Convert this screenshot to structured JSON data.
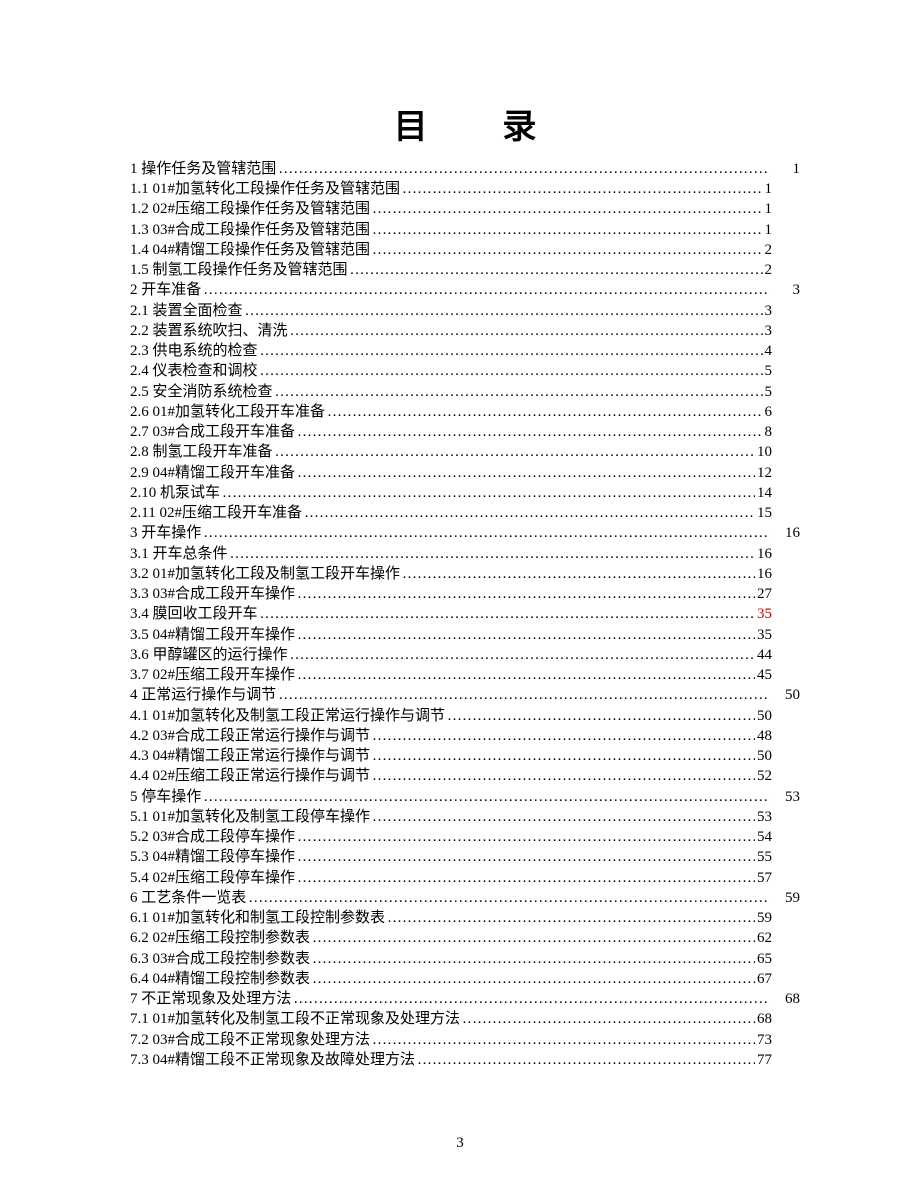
{
  "title_part1": "目",
  "title_part2": "录",
  "page_number": "3",
  "toc": [
    {
      "label": "1  操作任务及管辖范围",
      "page": "1",
      "level": 1
    },
    {
      "label": "1.1 01#加氢转化工段操作任务及管辖范围",
      "page": "1",
      "level": 2
    },
    {
      "label": "1.2 02#压缩工段操作任务及管辖范围",
      "page": "1",
      "level": 2
    },
    {
      "label": "1.3 03#合成工段操作任务及管辖范围",
      "page": "1",
      "level": 2
    },
    {
      "label": "1.4 04#精馏工段操作任务及管辖范围",
      "page": "2",
      "level": 2
    },
    {
      "label": "1.5  制氢工段操作任务及管辖范围",
      "page": "2",
      "level": 2
    },
    {
      "label": "2  开车准备",
      "page": "3",
      "level": 1
    },
    {
      "label": "2.1  装置全面检查",
      "page": "3",
      "level": 2
    },
    {
      "label": "2.2  装置系统吹扫、清洗",
      "page": "3",
      "level": 2
    },
    {
      "label": "2.3  供电系统的检查",
      "page": "4",
      "level": 2
    },
    {
      "label": "2.4  仪表检查和调校",
      "page": "5",
      "level": 2
    },
    {
      "label": "2.5  安全消防系统检查",
      "page": "5",
      "level": 2
    },
    {
      "label": "2.6 01#加氢转化工段开车准备",
      "page": "6",
      "level": 2
    },
    {
      "label": "2.7 03#合成工段开车准备",
      "page": "8",
      "level": 2
    },
    {
      "label": "2.8  制氢工段开车准备",
      "page": "10",
      "level": 2
    },
    {
      "label": "2.9 04#精馏工段开车准备",
      "page": "12",
      "level": 2
    },
    {
      "label": "2.10  机泵试车",
      "page": "14",
      "level": 2
    },
    {
      "label": "2.11 02#压缩工段开车准备",
      "page": "15",
      "level": 2
    },
    {
      "label": "3  开车操作",
      "page": "16",
      "level": 1
    },
    {
      "label": "3.1  开车总条件",
      "page": "16",
      "level": 2
    },
    {
      "label": "3.2 01#加氢转化工段及制氢工段开车操作",
      "page": "16",
      "level": 2
    },
    {
      "label": "3.3 03#合成工段开车操作",
      "page": "27",
      "level": 2
    },
    {
      "label": "3.4  膜回收工段开车",
      "page": "35",
      "level": 2,
      "red": true
    },
    {
      "label": "3.5 04#精馏工段开车操作",
      "page": "35",
      "level": 2
    },
    {
      "label": "3.6  甲醇罐区的运行操作",
      "page": "44",
      "level": 2
    },
    {
      "label": "3.7 02#压缩工段开车操作",
      "page": "45",
      "level": 2
    },
    {
      "label": "4  正常运行操作与调节",
      "page": "50",
      "level": 1
    },
    {
      "label": "4.1 01#加氢转化及制氢工段正常运行操作与调节",
      "page": "50",
      "level": 2
    },
    {
      "label": "4.2 03#合成工段正常运行操作与调节",
      "page": "48",
      "level": 2
    },
    {
      "label": "4.3 04#精馏工段正常运行操作与调节",
      "page": "50",
      "level": 2
    },
    {
      "label": "4.4 02#压缩工段正常运行操作与调节",
      "page": "52",
      "level": 2
    },
    {
      "label": "5  停车操作",
      "page": "53",
      "level": 1
    },
    {
      "label": "5.1 01#加氢转化及制氢工段停车操作",
      "page": "53",
      "level": 2
    },
    {
      "label": "5.2 03#合成工段停车操作",
      "page": "54",
      "level": 2
    },
    {
      "label": "5.3 04#精馏工段停车操作",
      "page": "55",
      "level": 2
    },
    {
      "label": "5.4 02#压缩工段停车操作",
      "page": "57",
      "level": 2
    },
    {
      "label": "6  工艺条件一览表",
      "page": "59",
      "level": 1
    },
    {
      "label": "6.1 01#加氢转化和制氢工段控制参数表",
      "page": "59",
      "level": 2
    },
    {
      "label": "6.2 02#压缩工段控制参数表",
      "page": "62",
      "level": 2
    },
    {
      "label": "6.3 03#合成工段控制参数表",
      "page": "65",
      "level": 2
    },
    {
      "label": "6.4 04#精馏工段控制参数表",
      "page": "67",
      "level": 2
    },
    {
      "label": "7  不正常现象及处理方法",
      "page": "68",
      "level": 1
    },
    {
      "label": "7.1 01#加氢转化及制氢工段不正常现象及处理方法",
      "page": "68",
      "level": 2
    },
    {
      "label": "7.2 03#合成工段不正常现象处理方法",
      "page": "73",
      "level": 2
    },
    {
      "label": "7.3 04#精馏工段不正常现象及故障处理方法",
      "page": "77",
      "level": 2
    }
  ]
}
